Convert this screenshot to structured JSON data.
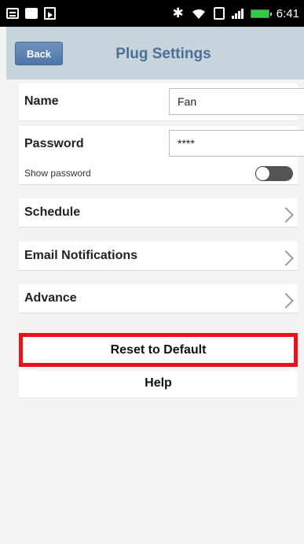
{
  "status_bar": {
    "time": "6:41",
    "left_icons": [
      "chat-icon",
      "photo-icon",
      "play-store-icon"
    ],
    "right_icons": [
      "bluetooth-icon",
      "wifi-icon",
      "nfc-icon",
      "signal-icon",
      "battery-icon"
    ],
    "battery_color": "#2ecc40"
  },
  "header": {
    "back_label": "Back",
    "title": "Plug Settings",
    "background": "#c7d4dc",
    "accent": "#4a6f98"
  },
  "settings": {
    "name": {
      "label": "Name",
      "value": "Fan"
    },
    "password": {
      "label": "Password",
      "value": "****"
    },
    "show_password": {
      "label": "Show password",
      "enabled": false
    }
  },
  "nav_items": [
    {
      "label": "Schedule"
    },
    {
      "label": "Email Notifications"
    },
    {
      "label": "Advance"
    }
  ],
  "actions": {
    "reset_label": "Reset to Default",
    "help_label": "Help",
    "highlight_color": "#e8131a"
  }
}
